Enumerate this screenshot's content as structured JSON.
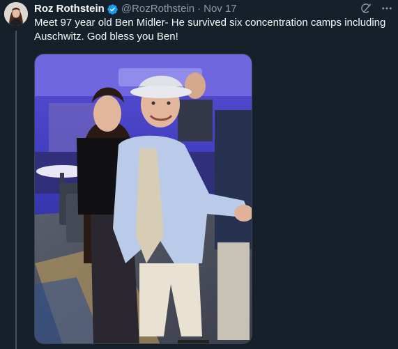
{
  "author": {
    "display_name": "Roz Rothstein",
    "handle": "@RozRothstein",
    "separator": "·",
    "date": "Nov 17",
    "verified": true,
    "accent_color": "#1d9bf0"
  },
  "tweet": {
    "text": "Meet 97 year old Ben Midler- He survived six concentration camps including Auschwitz. God bless you Ben!"
  },
  "icons": {
    "grok": "grok-icon",
    "more": "more-options-icon",
    "verified": "verified-badge-icon"
  },
  "colors": {
    "background": "#15202b",
    "text_primary": "#f7f9f9",
    "text_secondary": "#8b98a5",
    "thread_line": "#425364"
  }
}
